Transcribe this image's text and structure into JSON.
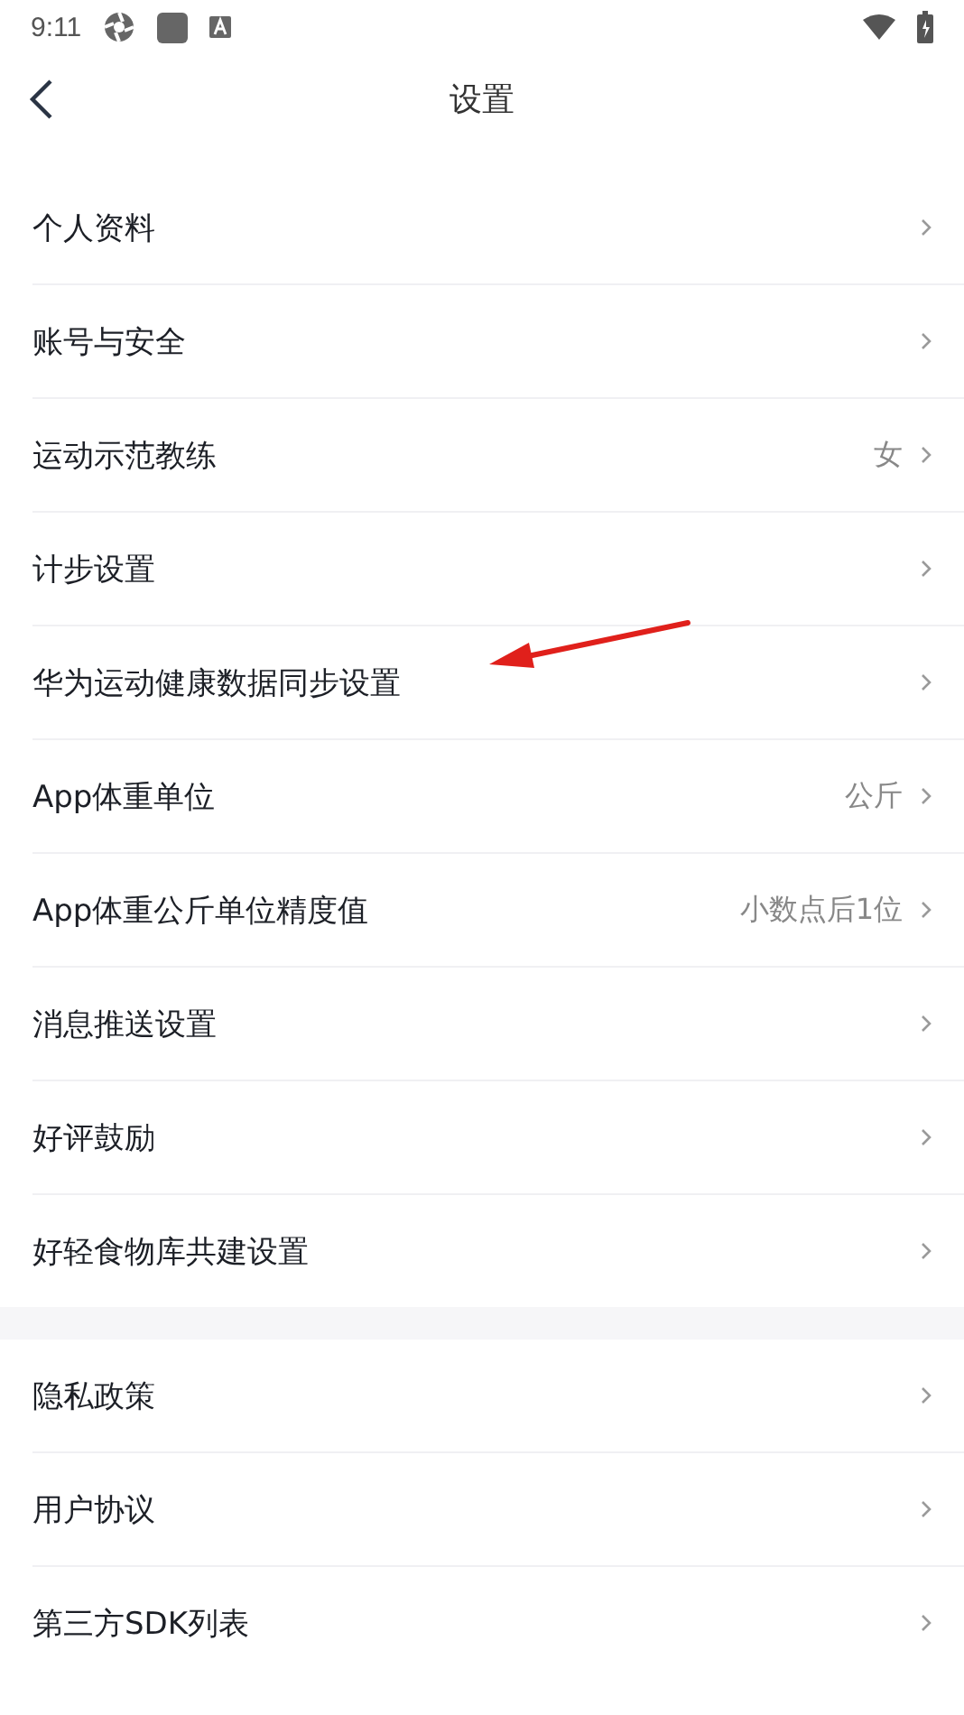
{
  "status_bar": {
    "time": "9:11"
  },
  "header": {
    "title": "设置"
  },
  "groups": [
    {
      "rows": [
        {
          "label": "个人资料"
        },
        {
          "label": "账号与安全"
        },
        {
          "label": "运动示范教练",
          "value": "女"
        },
        {
          "label": "计步设置"
        },
        {
          "label": "华为运动健康数据同步设置"
        },
        {
          "label": "App体重单位",
          "value": "公斤"
        },
        {
          "label": "App体重公斤单位精度值",
          "value": "小数点后1位"
        },
        {
          "label": "消息推送设置"
        },
        {
          "label": "好评鼓励"
        },
        {
          "label": "好轻食物库共建设置"
        }
      ]
    },
    {
      "rows": [
        {
          "label": "隐私政策"
        },
        {
          "label": "用户协议"
        },
        {
          "label": "第三方SDK列表"
        }
      ]
    }
  ]
}
